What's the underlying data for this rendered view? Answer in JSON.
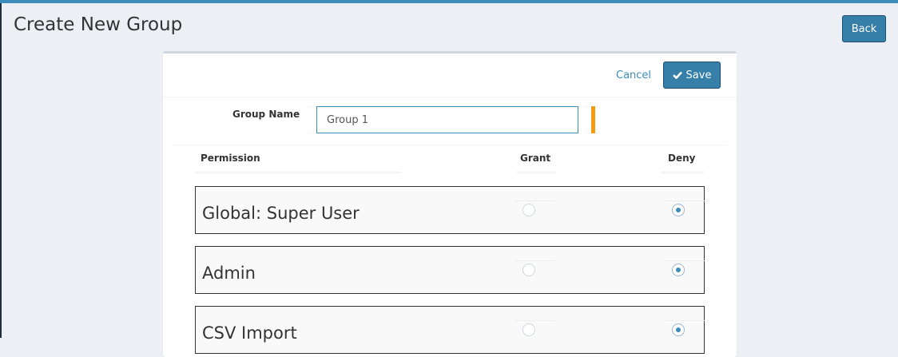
{
  "page": {
    "title": "Create New Group",
    "back_label": "Back"
  },
  "form": {
    "cancel_label": "Cancel",
    "save_label": "Save",
    "group_name_label": "Group Name",
    "group_name_value": "Group 1"
  },
  "table": {
    "headers": {
      "permission": "Permission",
      "grant": "Grant",
      "deny": "Deny"
    },
    "rows": [
      {
        "name": "Global: Super User",
        "selected": "deny"
      },
      {
        "name": "Admin",
        "selected": "deny"
      },
      {
        "name": "CSV Import",
        "selected": "deny"
      }
    ]
  },
  "icons": {
    "save": "check-icon"
  },
  "colors": {
    "primary": "#367fa9",
    "link": "#3c8dbc",
    "required": "#f39c12",
    "background": "#ecf0f5"
  }
}
